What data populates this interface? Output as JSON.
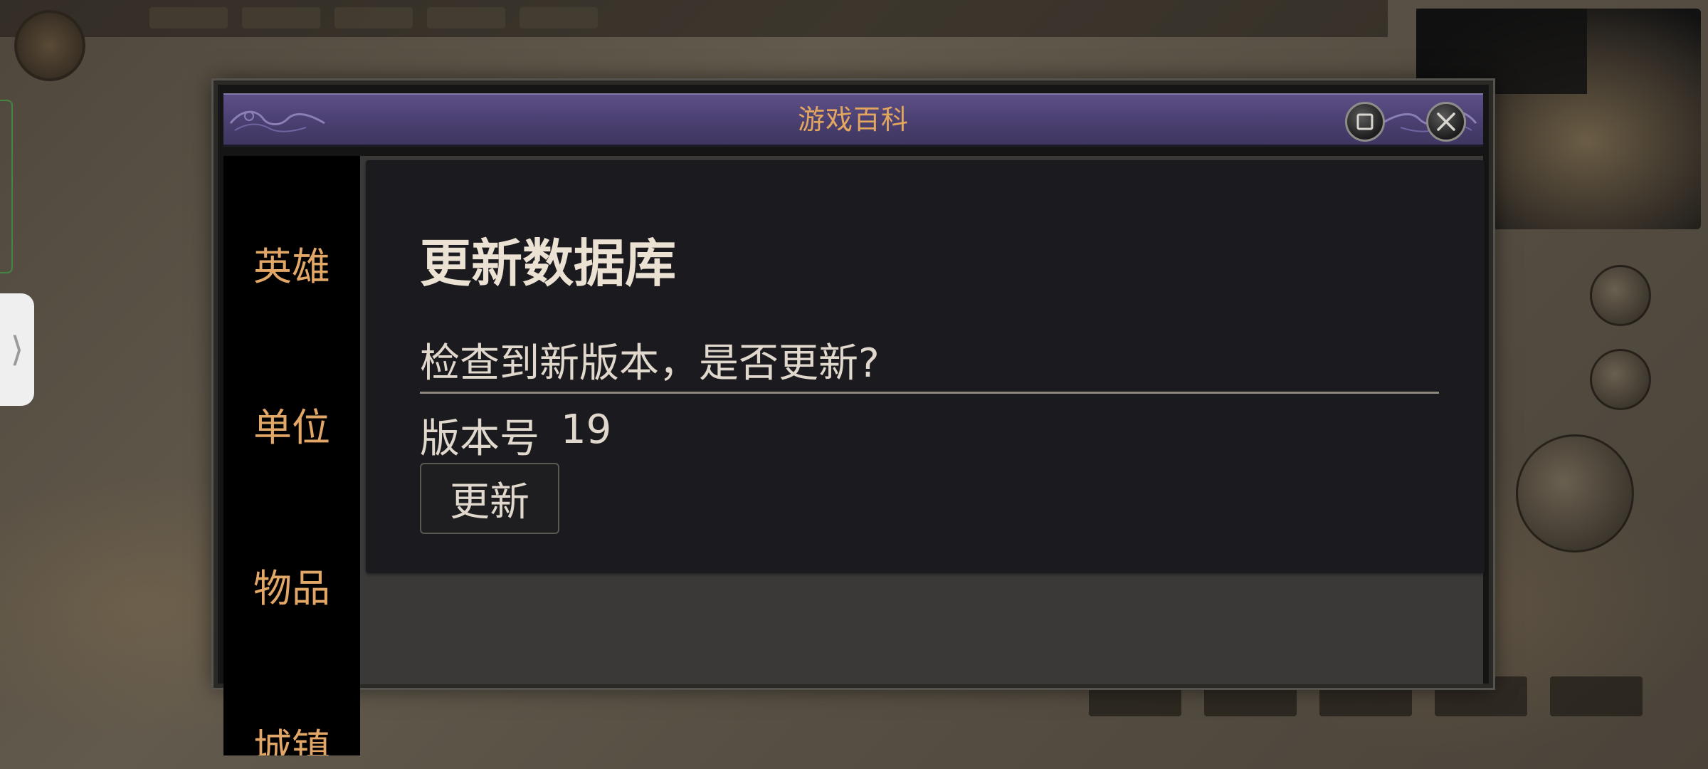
{
  "dialog": {
    "title": "游戏百科"
  },
  "sidebar": {
    "items": [
      {
        "label": "英雄"
      },
      {
        "label": "单位"
      },
      {
        "label": "物品"
      },
      {
        "label": "城镇"
      }
    ]
  },
  "update_panel": {
    "heading": "更新数据库",
    "prompt": "检查到新版本，是否更新?",
    "version_label": "版本号",
    "version_value": "19",
    "update_button_label": "更新"
  },
  "icons": {
    "maximize": "maximize-icon",
    "close": "close-icon",
    "side_tab": "chevron-right-icon"
  },
  "colors": {
    "title_bar": "#4a3f70",
    "title_text": "#e3a65f",
    "nav_text": "#e2a767",
    "card_bg": "#1b1a1e"
  }
}
